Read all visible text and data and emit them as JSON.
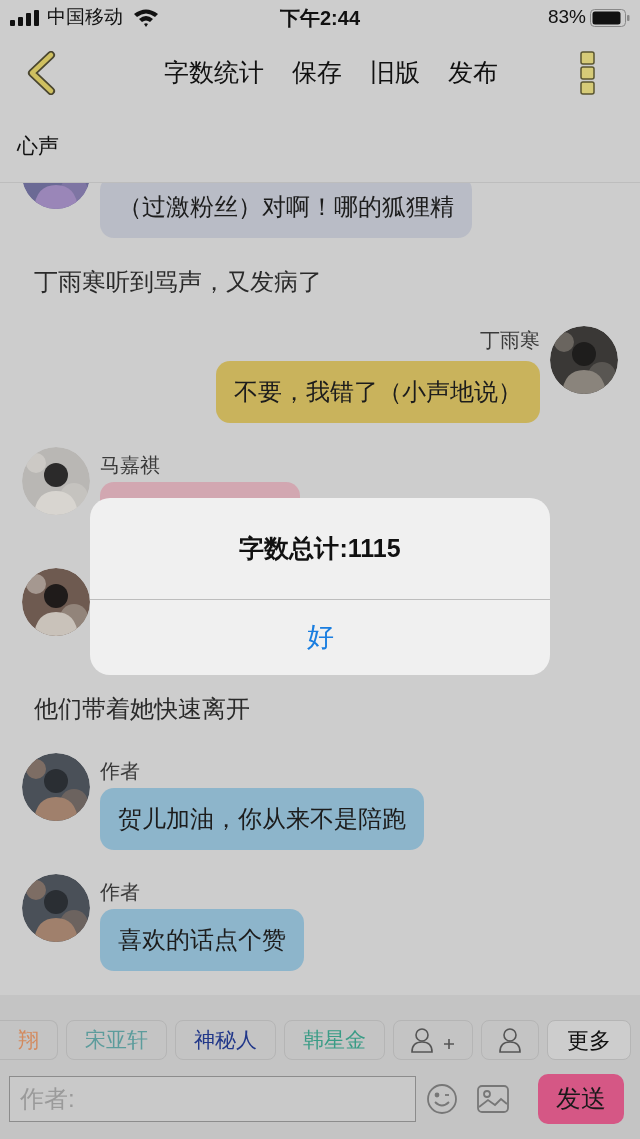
{
  "status_bar": {
    "carrier": "中国移动",
    "time": "下午2:44",
    "battery": "83%"
  },
  "nav": {
    "actions": [
      "字数统计",
      "保存",
      "旧版",
      "发布"
    ]
  },
  "section": {
    "title": "心声"
  },
  "messages": [
    {
      "kind": "incoming",
      "text": "（过激粉丝）对啊！哪的狐狸精",
      "color": "#b9bcc6"
    },
    {
      "kind": "narration",
      "text": "丁雨寒听到骂声，又发病了"
    },
    {
      "kind": "outgoing",
      "name": "丁雨寒",
      "text": "不要，我错了（小声地说）",
      "color": "#c9b35c"
    },
    {
      "kind": "incoming",
      "name": "马嘉祺",
      "color": "#d2a7b1"
    },
    {
      "kind": "incoming"
    },
    {
      "kind": "narration",
      "text": "他们带着她快速离开"
    },
    {
      "kind": "incoming",
      "name": "作者",
      "text": "贺儿加油，你从来不是陪跑",
      "color": "#8db5cb"
    },
    {
      "kind": "incoming",
      "name": "作者",
      "text": "喜欢的话点个赞",
      "color": "#8db5cb"
    }
  ],
  "roles": [
    {
      "kind": "name",
      "label": "翔",
      "color": "#d38a5e"
    },
    {
      "kind": "name",
      "label": "宋亚轩",
      "color": "#5c9c9c"
    },
    {
      "kind": "name",
      "label": "神秘人",
      "color": "#22388a"
    },
    {
      "kind": "name",
      "label": "韩星金",
      "color": "#3a9c86"
    },
    {
      "kind": "add_role"
    },
    {
      "kind": "role"
    },
    {
      "kind": "more",
      "label": "更多"
    }
  ],
  "composer": {
    "placeholder": "作者:",
    "send": "发送"
  },
  "alert": {
    "title": "字数总计:1115",
    "button": "好"
  }
}
